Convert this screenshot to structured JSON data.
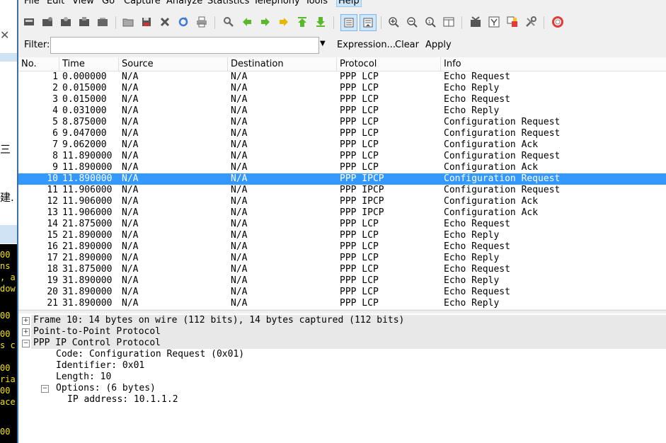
{
  "menu": [
    {
      "label": "File",
      "active": false
    },
    {
      "label": "Edit",
      "active": false
    },
    {
      "label": "View",
      "active": false
    },
    {
      "label": "Go",
      "active": false
    },
    {
      "label": "Capture",
      "active": false
    },
    {
      "label": "Analyze",
      "active": false
    },
    {
      "label": "Statistics",
      "active": false
    },
    {
      "label": "Telephony",
      "active": false
    },
    {
      "label": "Tools",
      "active": false
    },
    {
      "label": "Help",
      "active": true
    }
  ],
  "toolbar_icons": [
    "interface-list-icon",
    "capture-options-icon",
    "start-capture-icon",
    "stop-capture-icon",
    "restart-capture-icon",
    "open-file-icon",
    "save-file-icon",
    "close-file-icon",
    "reload-icon",
    "print-icon",
    "find-packet-icon",
    "go-back-icon",
    "go-forward-icon",
    "go-to-packet-icon",
    "go-first-packet-icon",
    "go-last-packet-icon",
    "colorize-icon",
    "auto-scroll-icon",
    "zoom-in-icon",
    "zoom-out-icon",
    "zoom-normal-icon",
    "resize-columns-icon",
    "capture-filters-icon",
    "display-filters-icon",
    "coloring-rules-icon",
    "preferences-icon",
    "help-icon"
  ],
  "filter": {
    "label": "Filter:",
    "value": "",
    "expression": "Expression...",
    "clear": "Clear",
    "apply": "Apply"
  },
  "columns": [
    "No.",
    "Time",
    "Source",
    "Destination",
    "Protocol",
    "Info"
  ],
  "packets": [
    {
      "no": "1",
      "time": "0.000000",
      "src": "N/A",
      "dst": "N/A",
      "proto": "PPP LCP",
      "info": "Echo Request"
    },
    {
      "no": "2",
      "time": "0.015000",
      "src": "N/A",
      "dst": "N/A",
      "proto": "PPP LCP",
      "info": "Echo Reply"
    },
    {
      "no": "3",
      "time": "0.015000",
      "src": "N/A",
      "dst": "N/A",
      "proto": "PPP LCP",
      "info": "Echo Request"
    },
    {
      "no": "4",
      "time": "0.031000",
      "src": "N/A",
      "dst": "N/A",
      "proto": "PPP LCP",
      "info": "Echo Reply"
    },
    {
      "no": "5",
      "time": "8.875000",
      "src": "N/A",
      "dst": "N/A",
      "proto": "PPP LCP",
      "info": "Configuration Request"
    },
    {
      "no": "6",
      "time": "9.047000",
      "src": "N/A",
      "dst": "N/A",
      "proto": "PPP LCP",
      "info": "Configuration Request"
    },
    {
      "no": "7",
      "time": "9.062000",
      "src": "N/A",
      "dst": "N/A",
      "proto": "PPP LCP",
      "info": "Configuration Ack"
    },
    {
      "no": "8",
      "time": "11.890000",
      "src": "N/A",
      "dst": "N/A",
      "proto": "PPP LCP",
      "info": "Configuration Request"
    },
    {
      "no": "9",
      "time": "11.890000",
      "src": "N/A",
      "dst": "N/A",
      "proto": "PPP LCP",
      "info": "Configuration Ack"
    },
    {
      "no": "10",
      "time": "11.890000",
      "src": "N/A",
      "dst": "N/A",
      "proto": "PPP IPCP",
      "info": "Configuration Request",
      "selected": true
    },
    {
      "no": "11",
      "time": "11.906000",
      "src": "N/A",
      "dst": "N/A",
      "proto": "PPP IPCP",
      "info": "Configuration Request"
    },
    {
      "no": "12",
      "time": "11.906000",
      "src": "N/A",
      "dst": "N/A",
      "proto": "PPP IPCP",
      "info": "Configuration Ack"
    },
    {
      "no": "13",
      "time": "11.906000",
      "src": "N/A",
      "dst": "N/A",
      "proto": "PPP IPCP",
      "info": "Configuration Ack"
    },
    {
      "no": "14",
      "time": "21.875000",
      "src": "N/A",
      "dst": "N/A",
      "proto": "PPP LCP",
      "info": "Echo Request"
    },
    {
      "no": "15",
      "time": "21.890000",
      "src": "N/A",
      "dst": "N/A",
      "proto": "PPP LCP",
      "info": "Echo Reply"
    },
    {
      "no": "16",
      "time": "21.890000",
      "src": "N/A",
      "dst": "N/A",
      "proto": "PPP LCP",
      "info": "Echo Request"
    },
    {
      "no": "17",
      "time": "21.890000",
      "src": "N/A",
      "dst": "N/A",
      "proto": "PPP LCP",
      "info": "Echo Reply"
    },
    {
      "no": "18",
      "time": "31.875000",
      "src": "N/A",
      "dst": "N/A",
      "proto": "PPP LCP",
      "info": "Echo Request"
    },
    {
      "no": "19",
      "time": "31.890000",
      "src": "N/A",
      "dst": "N/A",
      "proto": "PPP LCP",
      "info": "Echo Reply"
    },
    {
      "no": "20",
      "time": "31.890000",
      "src": "N/A",
      "dst": "N/A",
      "proto": "PPP LCP",
      "info": "Echo Request"
    },
    {
      "no": "21",
      "time": "31.890000",
      "src": "N/A",
      "dst": "N/A",
      "proto": "PPP LCP",
      "info": "Echo Reply"
    }
  ],
  "details": [
    {
      "text": "Frame 10: 14 bytes on wire (112 bits), 14 bytes captured (112 bits)",
      "expander": "+",
      "level": 0
    },
    {
      "text": "Point-to-Point Protocol",
      "expander": "+",
      "level": 0
    },
    {
      "text": "PPP IP Control Protocol",
      "expander": "−",
      "level": 0
    },
    {
      "text": "Code: Configuration Request (0x01)",
      "expander": "",
      "level": 1
    },
    {
      "text": "Identifier: 0x01",
      "expander": "",
      "level": 1
    },
    {
      "text": "Length: 10",
      "expander": "",
      "level": 1
    },
    {
      "text": "Options: (6 bytes)",
      "expander": "−",
      "level": 1
    },
    {
      "text": "IP address: 10.1.1.2",
      "expander": "",
      "level": 2
    }
  ],
  "background_window": {
    "chars": [
      "三",
      "建."
    ],
    "terminal_lines": [
      "00",
      "ns",
      ", a",
      "dow",
      "00",
      "00",
      "s c",
      "00",
      "ria",
      "00",
      "ace",
      "00"
    ]
  },
  "colors": {
    "selection": "#3399ff",
    "accent": "#3d6fa5"
  }
}
